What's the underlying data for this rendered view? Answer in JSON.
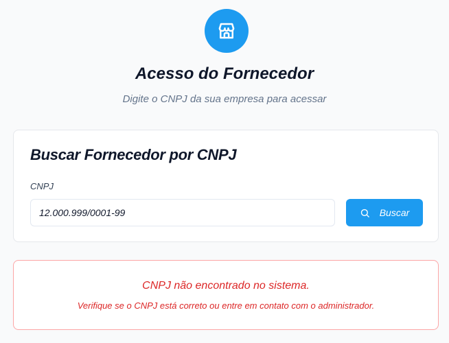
{
  "header": {
    "logo_icon": "store-icon",
    "title": "Acesso do Fornecedor",
    "subtitle": "Digite o CNPJ da sua empresa para acessar"
  },
  "search_card": {
    "title": "Buscar Fornecedor por CNPJ",
    "cnpj_label": "CNPJ",
    "cnpj_value": "12.000.999/0001-99",
    "search_button_icon": "search-icon",
    "search_button_label": "Buscar"
  },
  "error": {
    "title": "CNPJ não encontrado no sistema.",
    "detail": "Verifique se o CNPJ está correto ou entre em contato com o administrador."
  },
  "colors": {
    "accent": "#1d9bf0",
    "error": "#dc2626",
    "error_border": "#fca5a5"
  }
}
